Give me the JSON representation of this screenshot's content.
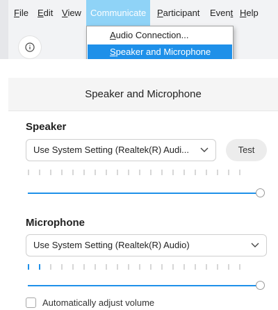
{
  "menubar": {
    "items": [
      {
        "label": "File"
      },
      {
        "label": "Edit"
      },
      {
        "label": "View"
      },
      {
        "label": "Communicate"
      },
      {
        "label": "Participant"
      },
      {
        "label": "Event"
      },
      {
        "label": "Help"
      }
    ]
  },
  "dropdown": {
    "items": [
      {
        "label": "Audio Connection..."
      },
      {
        "label": "Speaker and Microphone"
      }
    ]
  },
  "panel": {
    "title": "Speaker and Microphone",
    "speaker": {
      "label": "Speaker",
      "device": "Use System Setting (Realtek(R) Audi...",
      "test_label": "Test",
      "level_active_bars": 0,
      "volume": 1.0
    },
    "microphone": {
      "label": "Microphone",
      "device": "Use System Setting (Realtek(R) Audio)",
      "level_active_bars": 2,
      "volume": 1.0
    },
    "auto_adjust": {
      "label": "Automatically adjust volume",
      "checked": false
    }
  },
  "colors": {
    "accent": "#1e90e9",
    "menu_active": "#8fd3f7"
  }
}
